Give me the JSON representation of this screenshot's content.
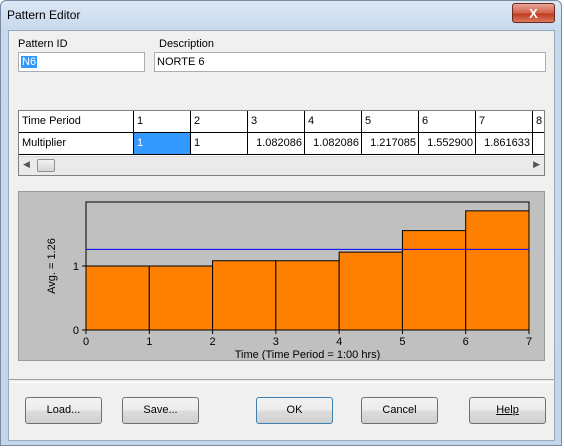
{
  "window": {
    "title": "Pattern Editor",
    "close_label": "X"
  },
  "pattern": {
    "id_label": "Pattern ID",
    "id_value": "N6",
    "description_label": "Description",
    "description_value": "NORTE 6"
  },
  "grid": {
    "row1_header": "Time Period",
    "row2_header": "Multiplier",
    "periods": [
      "1",
      "2",
      "3",
      "4",
      "5",
      "6",
      "7",
      "8"
    ],
    "multipliers": [
      "1",
      "1",
      "1.082086",
      "1.082086",
      "1.217085",
      "1.552900",
      "1.861633",
      ""
    ]
  },
  "chart_data": {
    "type": "bar",
    "categories": [
      "1",
      "2",
      "3",
      "4",
      "5",
      "6",
      "7"
    ],
    "values": [
      1,
      1,
      1.082086,
      1.082086,
      1.217085,
      1.5529,
      1.861633
    ],
    "average": 1.26,
    "ylabel": "Avg. = 1.26",
    "xlabel": "Time (Time Period = 1:00  hrs)",
    "xlim": [
      0,
      7
    ],
    "ylim": [
      0,
      2
    ],
    "x_ticks": [
      "0",
      "1",
      "2",
      "3",
      "4",
      "5",
      "6",
      "7"
    ],
    "y_ticks": [
      "0",
      "1"
    ],
    "bar_color": "#ff8000",
    "avg_line_color": "#0000ff",
    "plot_bg": "#c0c0c0"
  },
  "buttons": {
    "load": "Load...",
    "save": "Save...",
    "ok": "OK",
    "cancel": "Cancel",
    "help": "Help"
  }
}
